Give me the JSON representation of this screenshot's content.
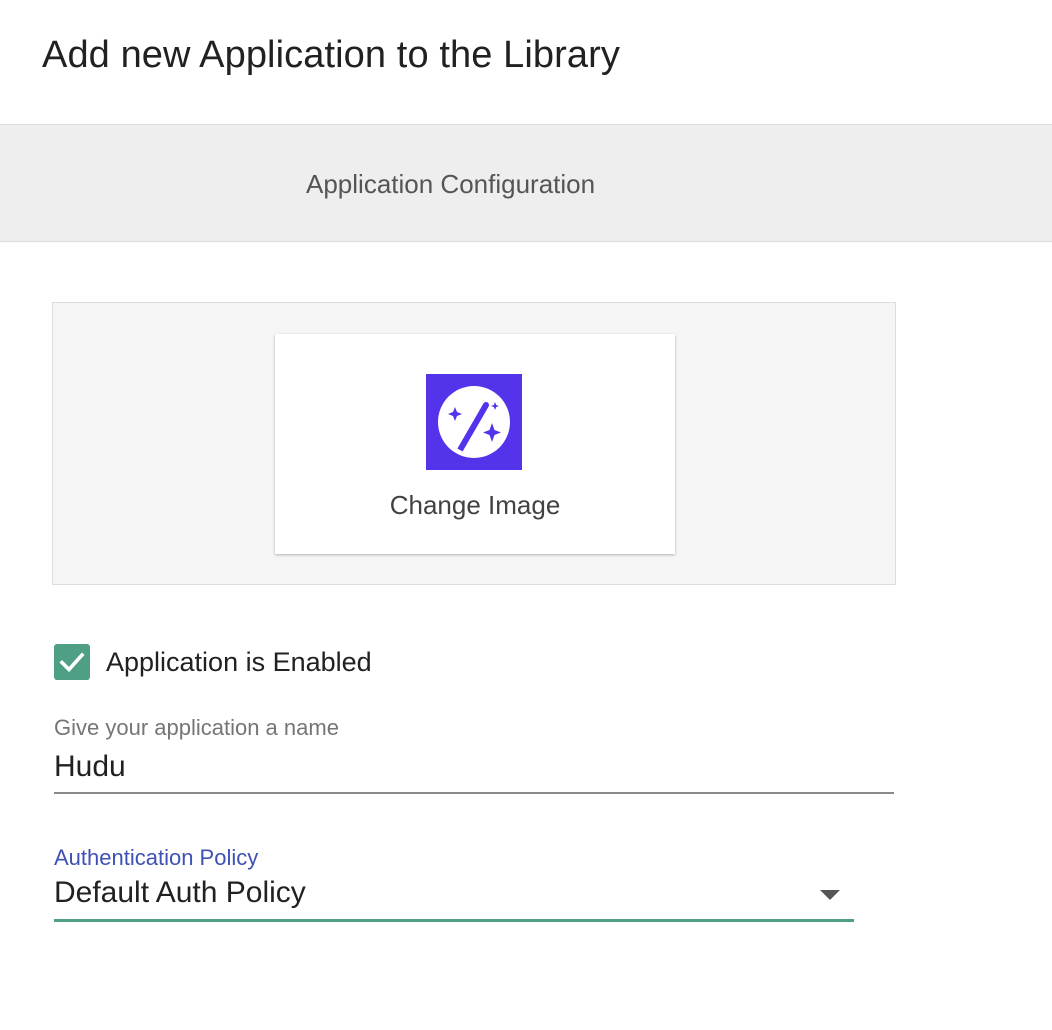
{
  "dialog": {
    "title": "Add new Application to the Library"
  },
  "tabs": [
    {
      "label": "Application Configuration",
      "active": true
    }
  ],
  "image_panel": {
    "icon": "magic-wand-icon",
    "icon_bg": "#5433eb",
    "change_label": "Change Image"
  },
  "enabled_checkbox": {
    "label": "Application is Enabled",
    "checked": true,
    "color": "#4f9e86"
  },
  "name_field": {
    "label": "Give your application a name",
    "value": "Hudu"
  },
  "auth_policy": {
    "label": "Authentication Policy",
    "value": "Default Auth Policy",
    "label_color": "#3f51b5",
    "underline_color": "#4f9e86"
  }
}
